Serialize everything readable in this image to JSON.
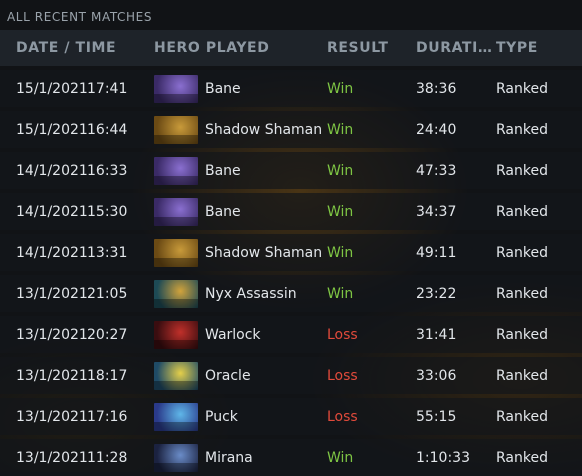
{
  "panel": {
    "title": "ALL RECENT MATCHES"
  },
  "columns": {
    "date_time": "DATE / TIME",
    "hero": "HERO PLAYED",
    "result": "RESULT",
    "duration": "DURATI…",
    "type": "TYPE"
  },
  "colors": {
    "win": "#7ec544",
    "loss": "#e04a3b"
  },
  "hero_colors": {
    "Bane": [
      "#3a2a66",
      "#8a6fd0"
    ],
    "Shadow Shaman": [
      "#6b4a14",
      "#c89a3a"
    ],
    "Nyx Assassin": [
      "#1d4a55",
      "#d1a33c"
    ],
    "Warlock": [
      "#3a0d10",
      "#c0302a"
    ],
    "Oracle": [
      "#1f4b66",
      "#e4cf4a"
    ],
    "Puck": [
      "#2a3a8a",
      "#5fb6e8"
    ],
    "Mirana": [
      "#1b2240",
      "#6a8cc8"
    ]
  },
  "matches": [
    {
      "date": "15/1/2021",
      "time": "17:41",
      "hero": "Bane",
      "result": "Win",
      "duration": "38:36",
      "type": "Ranked"
    },
    {
      "date": "15/1/2021",
      "time": "16:44",
      "hero": "Shadow Shaman",
      "result": "Win",
      "duration": "24:40",
      "type": "Ranked"
    },
    {
      "date": "14/1/2021",
      "time": "16:33",
      "hero": "Bane",
      "result": "Win",
      "duration": "47:33",
      "type": "Ranked"
    },
    {
      "date": "14/1/2021",
      "time": "15:30",
      "hero": "Bane",
      "result": "Win",
      "duration": "34:37",
      "type": "Ranked"
    },
    {
      "date": "14/1/2021",
      "time": "13:31",
      "hero": "Shadow Shaman",
      "result": "Win",
      "duration": "49:11",
      "type": "Ranked"
    },
    {
      "date": "13/1/2021",
      "time": "21:05",
      "hero": "Nyx Assassin",
      "result": "Win",
      "duration": "23:22",
      "type": "Ranked"
    },
    {
      "date": "13/1/2021",
      "time": "20:27",
      "hero": "Warlock",
      "result": "Loss",
      "duration": "31:41",
      "type": "Ranked"
    },
    {
      "date": "13/1/2021",
      "time": "18:17",
      "hero": "Oracle",
      "result": "Loss",
      "duration": "33:06",
      "type": "Ranked"
    },
    {
      "date": "13/1/2021",
      "time": "17:16",
      "hero": "Puck",
      "result": "Loss",
      "duration": "55:15",
      "type": "Ranked"
    },
    {
      "date": "13/1/2021",
      "time": "11:28",
      "hero": "Mirana",
      "result": "Win",
      "duration": "1:10:33",
      "type": "Ranked"
    }
  ]
}
